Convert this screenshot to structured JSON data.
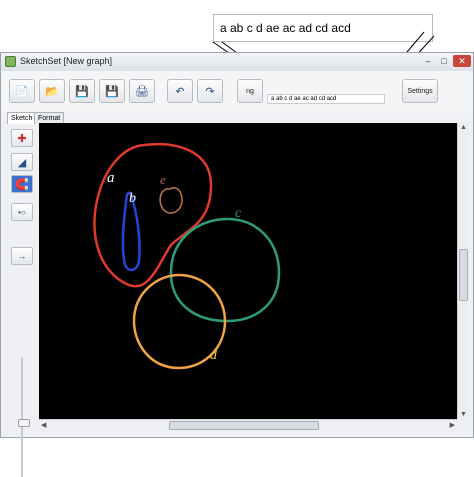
{
  "zoom_callout": {
    "text": "a ab c d ae ac ad cd acd"
  },
  "window": {
    "title": "SketchSet [New graph]",
    "minimize": "–",
    "maximize": "□",
    "close": "✕"
  },
  "toolbar": {
    "new_icon": "📄",
    "open_icon": "📂",
    "save_icon": "💾",
    "save_as_icon": "💾",
    "print_icon": "🖨",
    "undo_icon": "↶",
    "redo_icon": "↷",
    "set_input_value": "a ab c d ae ac ad cd acd",
    "settings_label": "Settings",
    "go_label": "ng"
  },
  "tabs": [
    {
      "label": "Sketch"
    },
    {
      "label": "Format"
    }
  ],
  "tools": {
    "t1": "✚",
    "t2": "◢",
    "t3": "🧲",
    "t4": "•○",
    "t5": "→"
  },
  "curve_labels": {
    "a1": "a",
    "b": "b",
    "e": "e",
    "c": "c",
    "d": "d"
  },
  "colors": {
    "a": "#e03a2f",
    "b": "#2846d6",
    "e": "#b5704a",
    "c": "#2f9b78",
    "d": "#f0a445",
    "label_white": "#ffffff",
    "label_d": "#f3c72b"
  }
}
